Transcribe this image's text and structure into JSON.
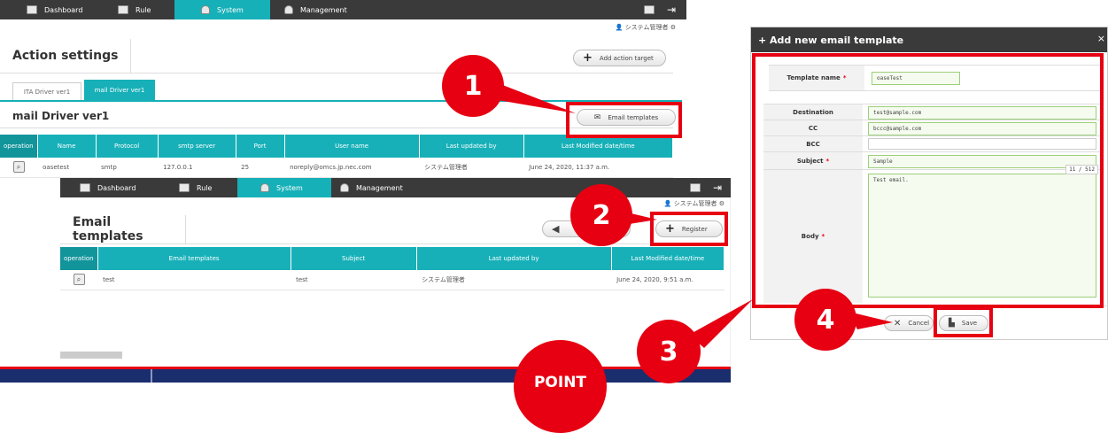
{
  "nav": {
    "dashboard": "Dashboard",
    "rule": "Rule",
    "system": "System",
    "management": "Management"
  },
  "user": {
    "name": "システム管理者"
  },
  "action_settings": {
    "title": "Action settings",
    "add_target": "Add action target",
    "tabs": [
      "ITA Driver ver1",
      "mail Driver ver1"
    ],
    "section_title": "mail Driver ver1",
    "email_templates_btn": "Email templates",
    "columns": [
      "operation",
      "Name",
      "Protocol",
      "smtp server",
      "Port",
      "User name",
      "Last updated by",
      "Last Modified date/time"
    ],
    "row": {
      "name": "oasetest",
      "protocol": "smtp",
      "server": "127.0.0.1",
      "port": "25",
      "user": "noreply@omcs.jp.nec.com",
      "updated_by": "システム管理者",
      "modified": "June 24, 2020, 11:37 a.m."
    }
  },
  "email_templates": {
    "title": "Email templates",
    "back_label": "gs",
    "register": "Register",
    "columns": [
      "operation",
      "Email templates",
      "Subject",
      "Last updated by",
      "Last Modified date/time"
    ],
    "row": {
      "name": "test",
      "subject": "test",
      "updated_by": "システム管理者",
      "modified": "June 24, 2020, 9:51 a.m."
    }
  },
  "dialog": {
    "title": "+ Add new email template",
    "template_name_label": "Template name",
    "template_name": "oaseTest",
    "destination_label": "Destination",
    "destination": "test@sample.com",
    "cc_label": "CC",
    "cc": "bccc@sample.com",
    "bcc_label": "BCC",
    "bcc": "",
    "subject_label": "Subject",
    "subject": "Sample",
    "body_label": "Body",
    "counter": "11 / 512",
    "body": "Test email.",
    "required_mark": "*",
    "cancel": "Cancel",
    "save": "Save"
  },
  "steps": [
    "1",
    "2",
    "3",
    "4"
  ],
  "point_label": "POINT",
  "colors": {
    "teal": "#17b0b8",
    "red": "#e60012",
    "navy": "#1a2e6e"
  }
}
